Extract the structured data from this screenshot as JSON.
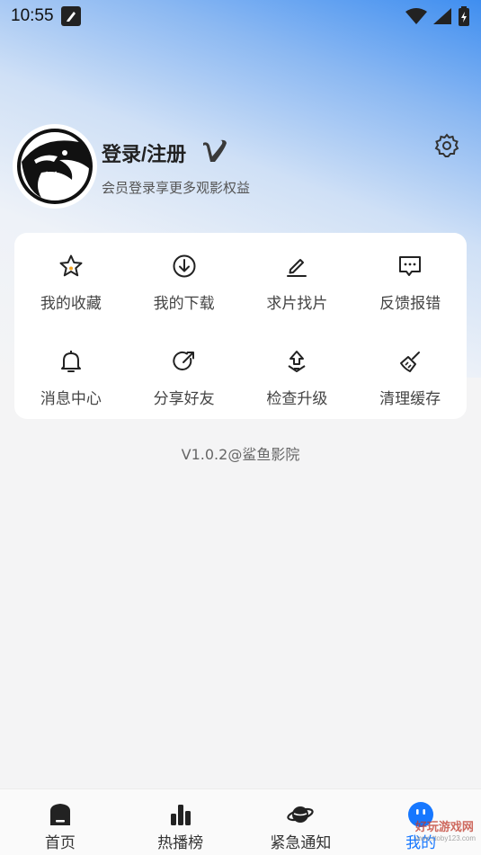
{
  "status": {
    "time": "10:55"
  },
  "profile": {
    "title": "登录/注册",
    "subtitle": "会员登录享更多观影权益",
    "vip_icon": "vip-v-icon",
    "settings_icon": "gear-icon"
  },
  "menu": [
    {
      "label": "我的收藏",
      "icon": "star-icon"
    },
    {
      "label": "我的下载",
      "icon": "download-icon"
    },
    {
      "label": "求片找片",
      "icon": "pencil-icon"
    },
    {
      "label": "反馈报错",
      "icon": "chat-bubble-icon"
    },
    {
      "label": "消息中心",
      "icon": "bell-icon"
    },
    {
      "label": "分享好友",
      "icon": "share-icon"
    },
    {
      "label": "检查升级",
      "icon": "upload-icon"
    },
    {
      "label": "清理缓存",
      "icon": "broom-icon"
    }
  ],
  "version": "V1.0.2@鲨鱼影院",
  "tabs": [
    {
      "label": "首页",
      "icon": "home-icon"
    },
    {
      "label": "热播榜",
      "icon": "bar-chart-icon"
    },
    {
      "label": "紧急通知",
      "icon": "planet-icon"
    },
    {
      "label": "我的",
      "icon": "smiley-icon"
    }
  ],
  "watermark": {
    "text": "好玩游戏网",
    "url": "www.ttoby123.com"
  },
  "colors": {
    "accent": "#1677ff",
    "card": "#ffffff",
    "background": "#f4f4f5"
  }
}
